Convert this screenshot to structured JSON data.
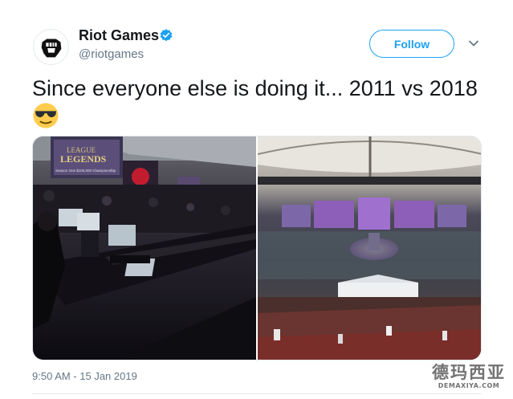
{
  "account": {
    "display_name": "Riot Games",
    "handle": "@riotgames",
    "verified": true,
    "avatar_icon": "riot-fist-logo-icon"
  },
  "actions": {
    "follow_label": "Follow",
    "more_icon": "chevron-down-icon"
  },
  "tweet": {
    "text": "Since everyone else is doing it... 2011 vs 2018",
    "emoji": "smiling-face-with-sunglasses-emoji",
    "timestamp": "9:50 AM - 15 Jan 2019"
  },
  "media": {
    "photos": [
      {
        "banner_text_line1": "LEAGUE",
        "banner_text_line2": "LEGENDS",
        "banner_text_line3": "Season One $100,000 Championship"
      },
      {}
    ]
  },
  "watermark": {
    "cn": "德玛西亚",
    "en": "DEMAXIYA.COM"
  },
  "colors": {
    "accent": "#1da1f2",
    "text": "#14171a",
    "secondary": "#657786"
  }
}
